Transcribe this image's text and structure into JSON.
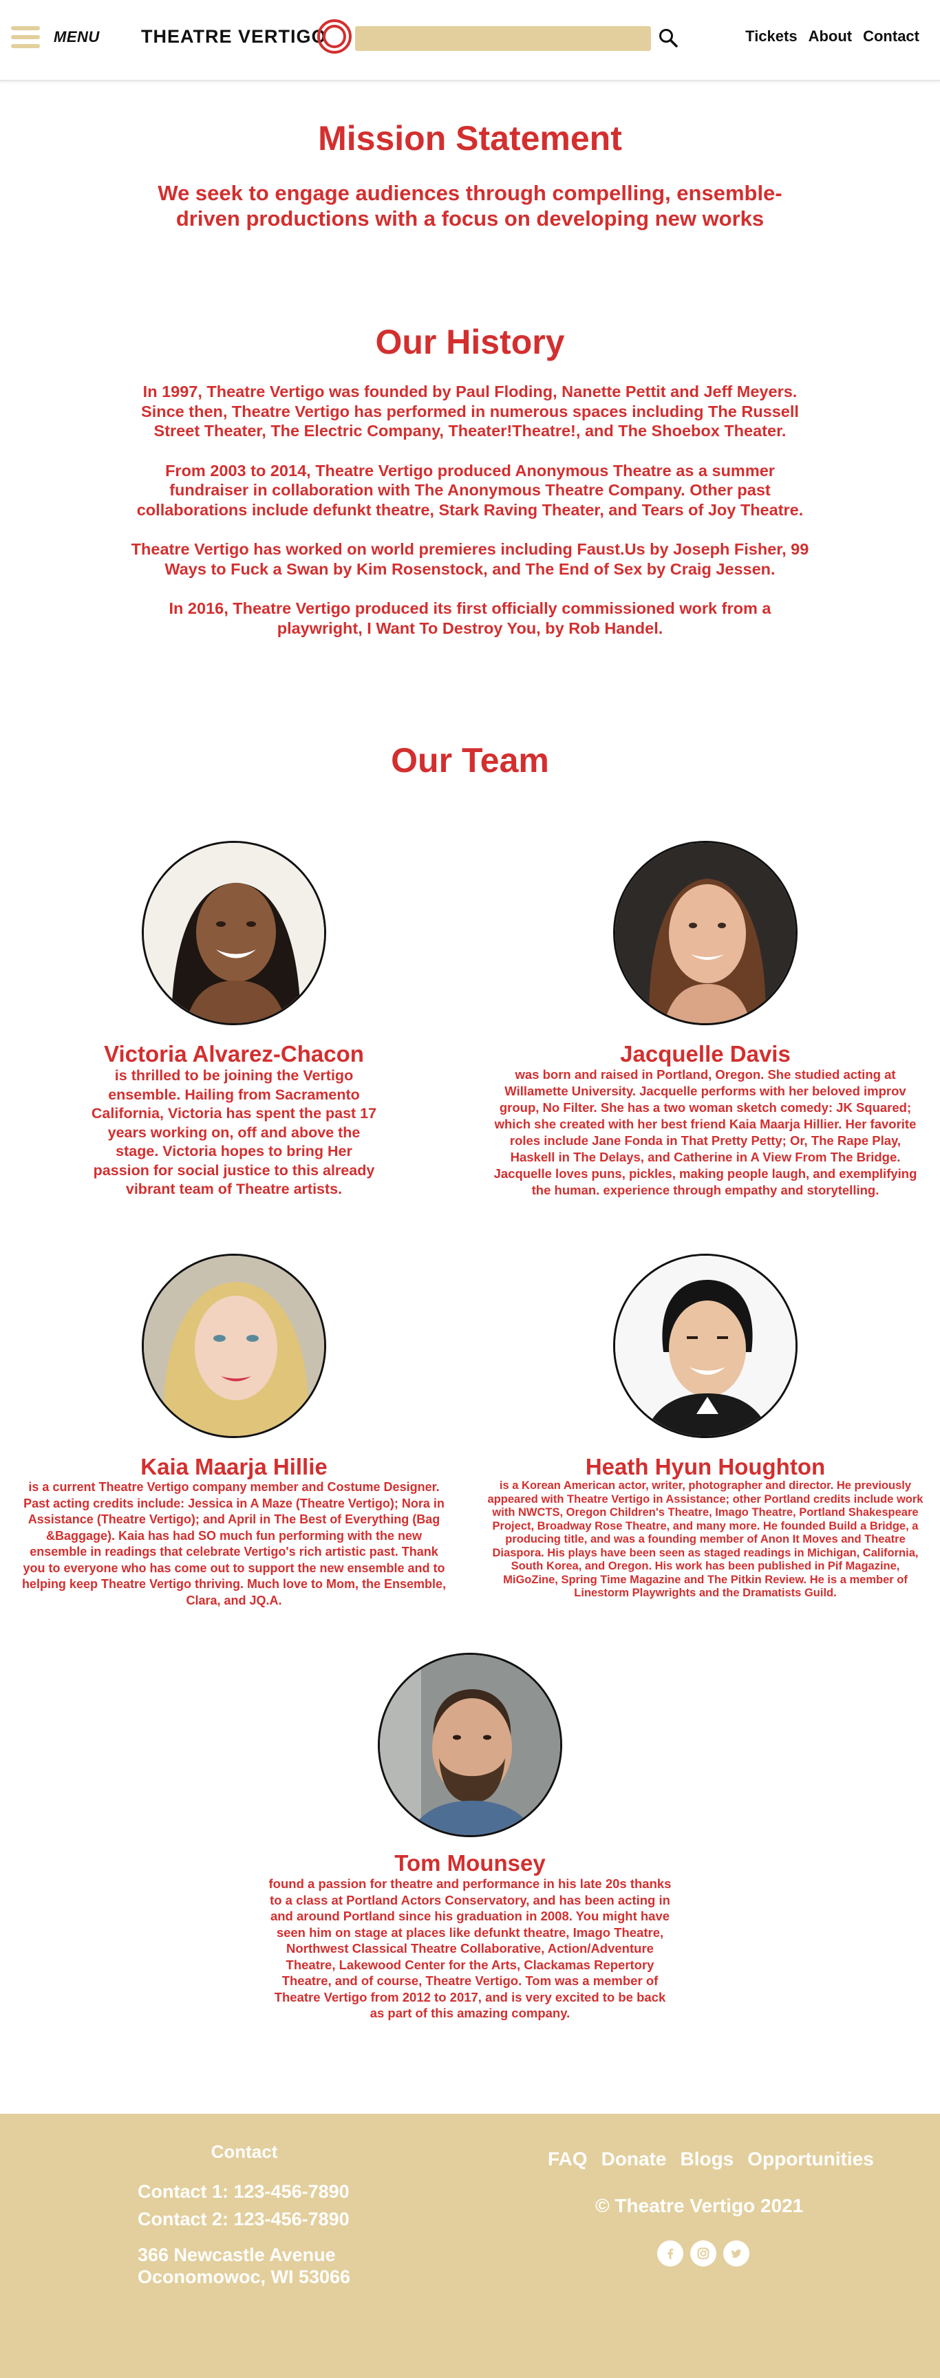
{
  "header": {
    "menu_label": "MENU",
    "logo_text": "THEATRE VERTIGO",
    "search_placeholder": "",
    "nav": [
      "Tickets",
      "About",
      "Contact"
    ]
  },
  "mission": {
    "title": "Mission Statement",
    "text": "We seek to engage audiences through compelling, ensemble-driven productions with a focus on developing new works"
  },
  "history": {
    "title": "Our History",
    "paragraphs": [
      "In 1997, Theatre Vertigo was founded by Paul Floding, Nanette Pettit and Jeff Meyers.  Since then, Theatre Vertigo has performed in numerous spaces including The Russell Street Theater, The Electric Company, Theater!Theatre!, and The Shoebox Theater.",
      "From 2003 to 2014, Theatre Vertigo produced Anonymous Theatre as a summer fundraiser in collaboration with The Anonymous Theatre Company.  Other past collaborations include defunkt theatre, Stark Raving Theater, and Tears of Joy Theatre.",
      "Theatre Vertigo has worked on world premieres including Faust.Us by Joseph Fisher, 99 Ways to Fuck a Swan by Kim Rosenstock, and The End of Sex by Craig Jessen.",
      "In 2016, Theatre Vertigo produced its first officially commissioned work from a playwright, I Want To Destroy You, by Rob Handel."
    ]
  },
  "team": {
    "title": "Our Team",
    "members": [
      {
        "name": "Victoria Alvarez-Chacon",
        "bio": "is thrilled to be joining the Vertigo ensemble. Hailing from Sacramento California, Victoria has spent the past 17 years working on, off and above the stage. Victoria hopes to bring Her passion for social justice to this already vibrant team of Theatre artists."
      },
      {
        "name": "Jacquelle Davis",
        "bio": "was born and raised in Portland, Oregon. She studied acting at Willamette University. Jacquelle performs with her beloved improv group, No Filter. She has a two woman sketch comedy: JK Squared; which she created with her best friend Kaia Maarja Hillier.  Her favorite roles include Jane Fonda in That Pretty Petty; Or, The Rape Play, Haskell in The Delays, and Catherine in A View From The Bridge. Jacquelle loves puns, pickles, making people laugh, and exemplifying the human. experience through empathy and storytelling."
      },
      {
        "name": "Kaia Maarja Hillie",
        "bio": "is a current Theatre Vertigo company member and Costume Designer. Past acting credits include: Jessica in A Maze (Theatre Vertigo); Nora in Assistance (Theatre Vertigo); and April in The Best of Everything (Bag &Baggage). Kaia has had SO much fun performing with the new ensemble in readings that celebrate Vertigo's rich artistic past. Thank you to everyone who has come out to support the new ensemble and to helping keep Theatre Vertigo thriving. Much love to Mom, the Ensemble, Clara, and JQ.A."
      },
      {
        "name": "Heath Hyun Houghton",
        "bio": "is a Korean American actor, writer, photographer and director. He previously appeared with Theatre Vertigo in Assistance; other Portland credits include work with NWCTS, Oregon Children's Theatre, Imago Theatre, Portland Shakespeare Project, Broadway Rose Theatre, and many more.  He founded Build a Bridge, a producing title, and was a founding member of Anon It Moves and Theatre Diaspora.  His plays have been seen as staged readings in Michigan, California, South Korea, and Oregon.  His work has been published in Pif Magazine, MiGoZine, Spring Time Magazine and The Pitkin Review.  He is a member of Linestorm Playwrights and the Dramatists Guild."
      },
      {
        "name": "Tom Mounsey",
        "bio": "found a passion for theatre and performance in his late 20s thanks to a class at Portland Actors Conservatory, and has been acting in and around Portland since his graduation in 2008. You might have seen him on stage at places like defunkt theatre, Imago Theatre, Northwest Classical Theatre Collaborative, Action/Adventure Theatre, Lakewood Center for the Arts, Clackamas Repertory Theatre, and of course, Theatre Vertigo. Tom was a member of Theatre Vertigo from 2012 to 2017, and is very excited to be back as part of this amazing company."
      }
    ]
  },
  "footer": {
    "contact_title": "Contact",
    "contact_1": "Contact 1: 123-456-7890",
    "contact_2": "Contact 2: 123-456-7890",
    "address_1": "366 Newcastle Avenue",
    "address_2": "Oconomowoc, WI 53066",
    "links": [
      "FAQ",
      "Donate",
      "Blogs",
      "Opportunities"
    ],
    "copyright": "© Theatre Vertigo 2021",
    "social": [
      "facebook-icon",
      "instagram-icon",
      "twitter-icon"
    ]
  },
  "colors": {
    "accent": "#d32f2f",
    "sand": "#e3cf9d",
    "ink": "#111111"
  }
}
